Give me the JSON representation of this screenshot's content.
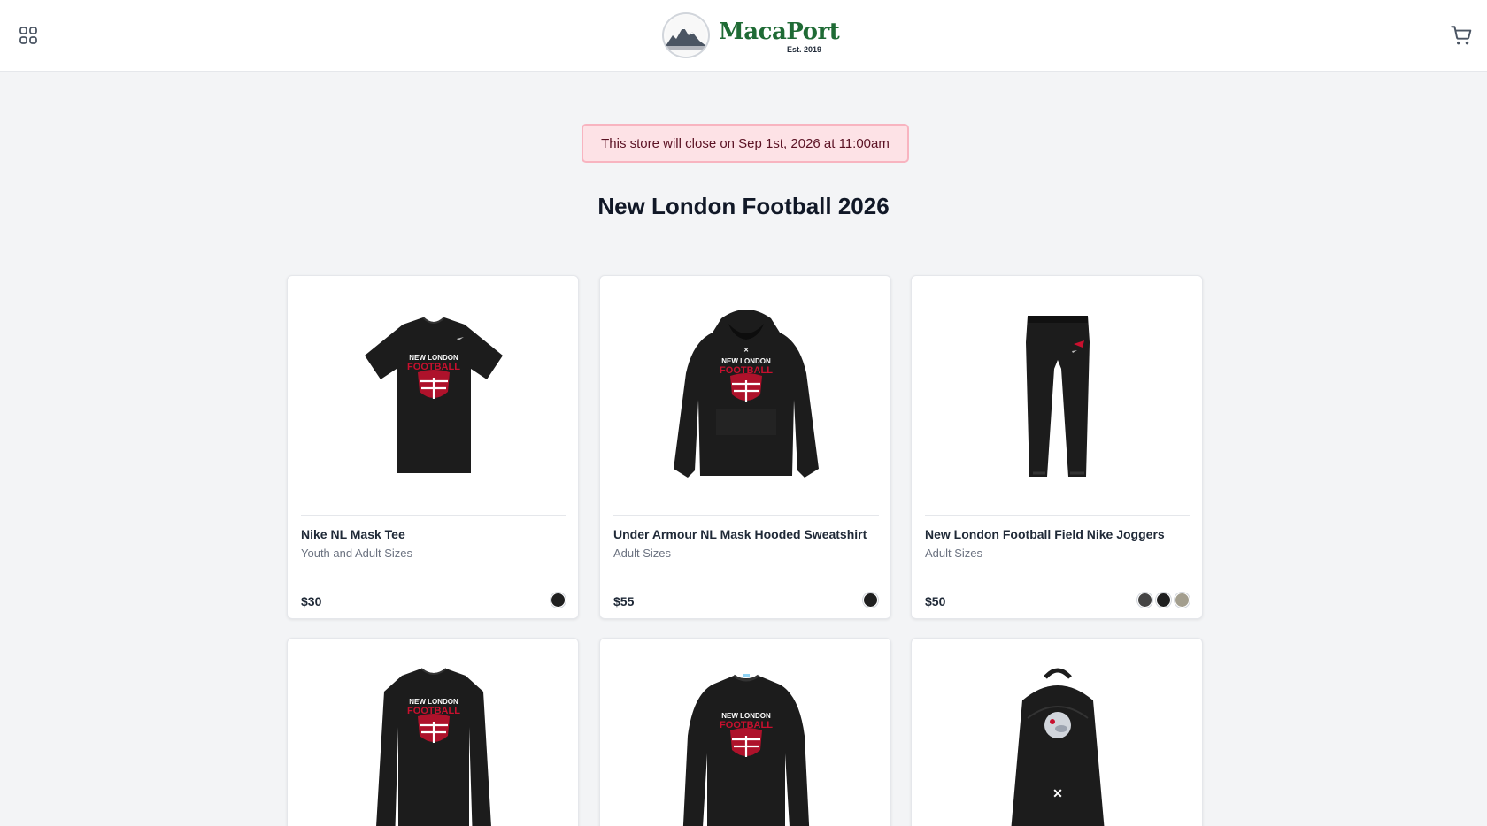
{
  "header": {
    "brand_name": "MacaPort",
    "brand_est": "Est. 2019",
    "menu_icon": "grid-menu-icon",
    "cart_icon": "cart-icon"
  },
  "notice": {
    "text": "This store will close on Sep 1st, 2026 at 11:00am"
  },
  "page": {
    "title": "New London Football 2026"
  },
  "products": [
    {
      "name": "Nike NL Mask Tee",
      "sizes": "Youth and Adult Sizes",
      "price": "$30",
      "colors": [
        "#1f1f1f"
      ]
    },
    {
      "name": "Under Armour NL Mask Hooded Sweatshirt",
      "sizes": "Adult Sizes",
      "price": "$55",
      "colors": [
        "#1f1f1f"
      ]
    },
    {
      "name": "New London Football Field Nike Joggers",
      "sizes": "Adult Sizes",
      "price": "$50",
      "colors": [
        "#444444",
        "#1f1f1f",
        "#a39e8e"
      ]
    },
    {
      "name": "",
      "sizes": "",
      "price": "",
      "colors": []
    },
    {
      "name": "",
      "sizes": "",
      "price": "",
      "colors": []
    },
    {
      "name": "",
      "sizes": "",
      "price": "",
      "colors": []
    }
  ],
  "graphic_text": {
    "line1": "NEW LONDON",
    "line2": "FOOTBALL"
  },
  "theme": {
    "brand_green": "#1f6b35",
    "notice_bg": "#fde2e6",
    "notice_border": "#f8b4c0",
    "accent_red": "#c8102e"
  }
}
